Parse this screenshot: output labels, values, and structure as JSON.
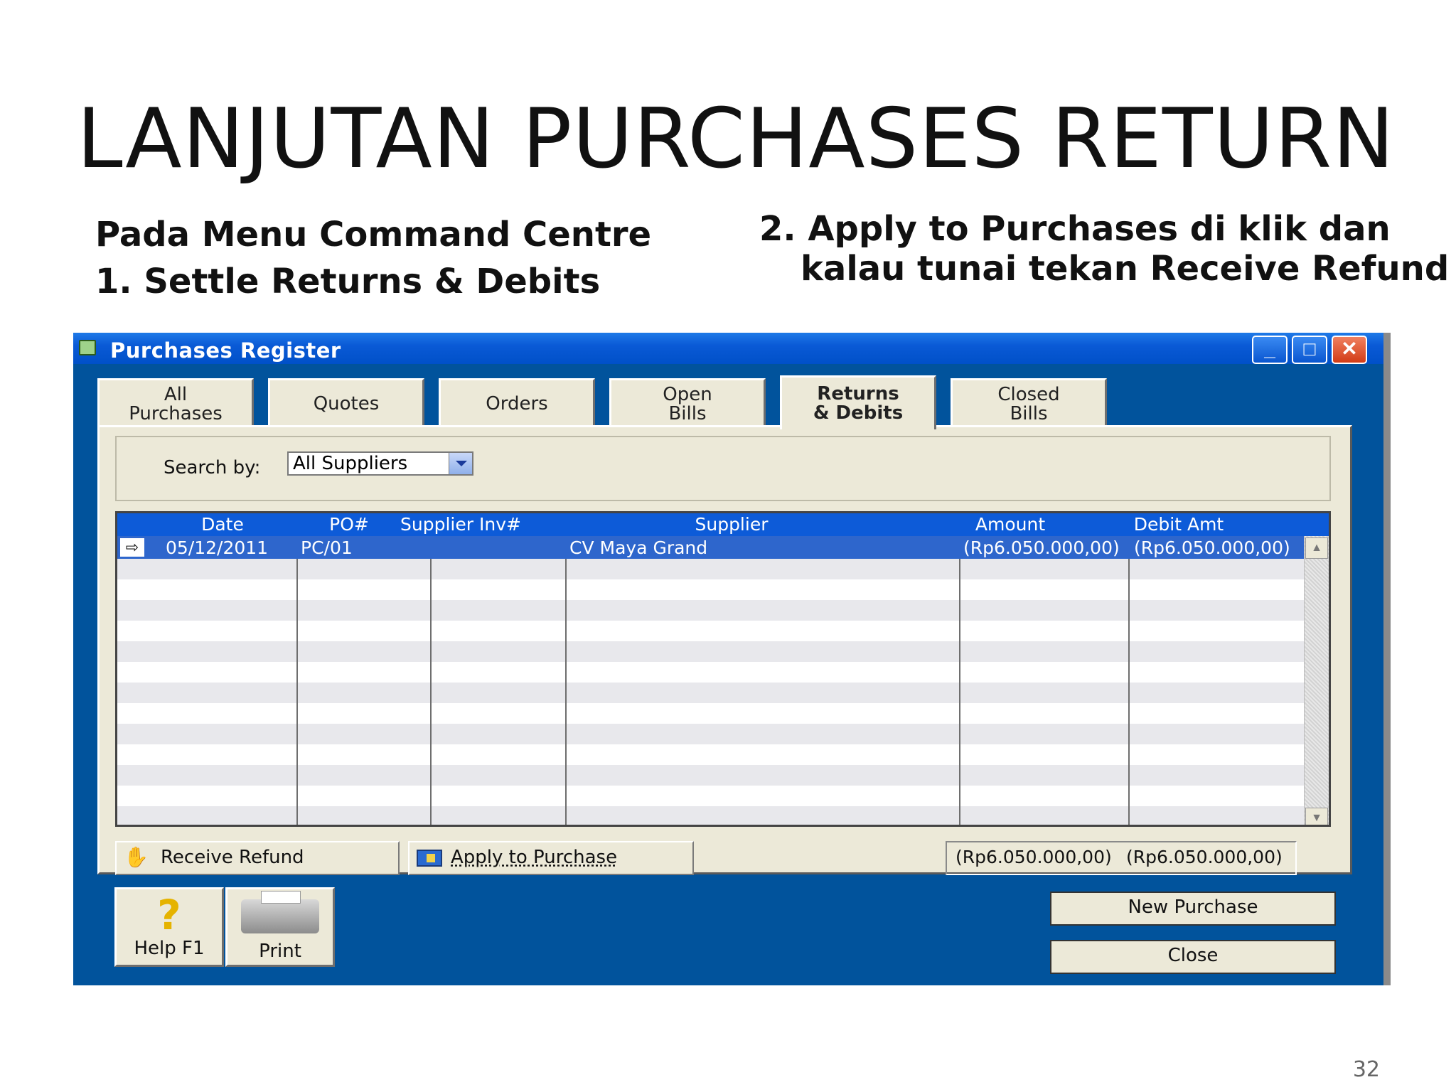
{
  "slide": {
    "title": "LANJUTAN PURCHASES RETURN",
    "note_left_line1": "Pada Menu Command Centre",
    "note_left_line2": "1. Settle Returns & Debits",
    "note_right_line1": "2.  Apply to Purchases di klik dan",
    "note_right_line2": "kalau tunai  tekan Receive Refund",
    "page_number": "32"
  },
  "window": {
    "title": "Purchases Register",
    "controls": {
      "minimize": "_",
      "maximize": "□",
      "close": "✕"
    },
    "tabs": [
      {
        "line1": "All",
        "line2": "Purchases"
      },
      {
        "line1": "Quotes",
        "line2": ""
      },
      {
        "line1": "Orders",
        "line2": ""
      },
      {
        "line1": "Open",
        "line2": "Bills"
      },
      {
        "line1": "Returns",
        "line2": "& Debits"
      },
      {
        "line1": "Closed",
        "line2": "Bills"
      }
    ],
    "active_tab": "Returns & Debits",
    "search": {
      "label": "Search by:",
      "value": "All Suppliers"
    },
    "grid": {
      "columns": [
        "Date",
        "PO#",
        "Supplier Inv#",
        "Supplier",
        "Amount",
        "Debit Amt"
      ],
      "rows": [
        {
          "date": "05/12/2011",
          "po": "PC/01",
          "supplier_inv": "",
          "supplier": "CV Maya Grand",
          "amount": "(Rp6.050.000,00)",
          "debit_amt": "(Rp6.050.000,00)"
        }
      ]
    },
    "buttons": {
      "receive_refund": "Receive Refund",
      "apply_to_purchase": "Apply to Purchase",
      "help": "Help F1",
      "print": "Print",
      "new_purchase": "New Purchase",
      "close": "Close"
    },
    "totals": {
      "amount": "(Rp6.050.000,00)",
      "debit_amt": "(Rp6.050.000,00)"
    }
  }
}
